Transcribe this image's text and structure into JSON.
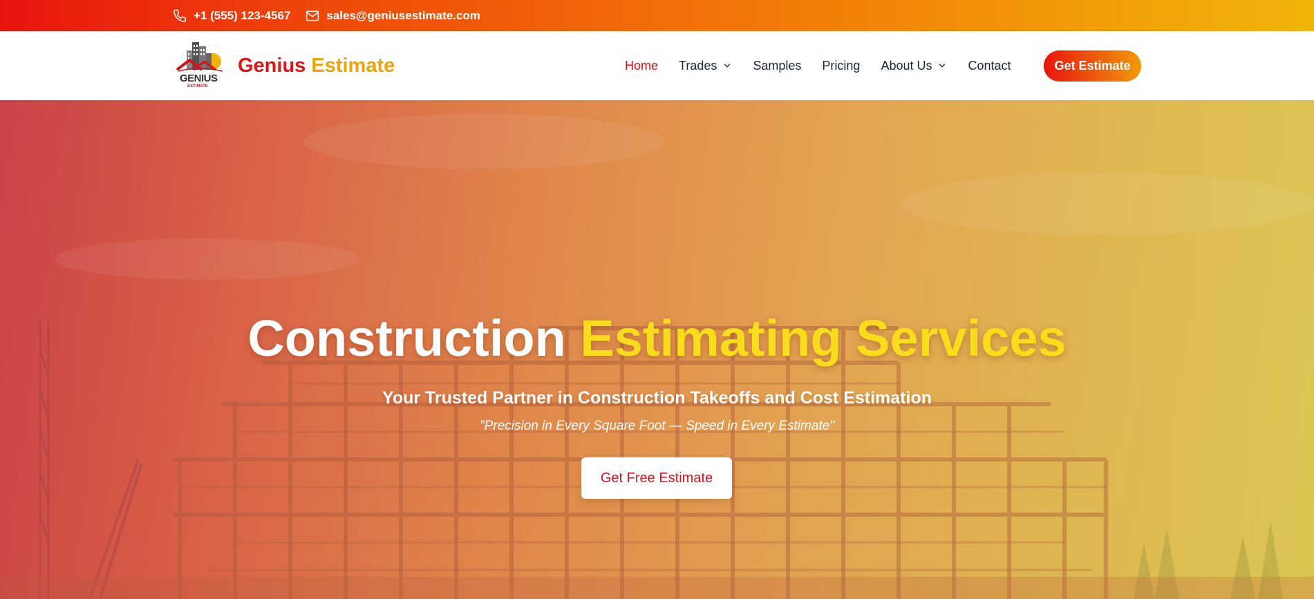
{
  "topbar": {
    "phone": "+1 (555) 123-4567",
    "email": "sales@geniusestimate.com"
  },
  "brand": {
    "logo_word": "GENIUS",
    "logo_sub": "ESTIMATE",
    "name_part1": "Genius",
    "name_part2": "Estimate"
  },
  "nav": {
    "items": [
      {
        "label": "Home",
        "active": true,
        "dropdown": false
      },
      {
        "label": "Trades",
        "active": false,
        "dropdown": true
      },
      {
        "label": "Samples",
        "active": false,
        "dropdown": false
      },
      {
        "label": "Pricing",
        "active": false,
        "dropdown": false
      },
      {
        "label": "About Us",
        "active": false,
        "dropdown": true
      },
      {
        "label": "Contact",
        "active": false,
        "dropdown": false
      }
    ],
    "cta_label": "Get Estimate"
  },
  "hero": {
    "title_part1": "Construction",
    "title_part2": "Estimating Services",
    "subtitle": "Your Trusted Partner in Construction Takeoffs and Cost Estimation",
    "quote": "\"Precision in Every Square Foot — Speed in Every Estimate\"",
    "button_label": "Get Free Estimate"
  },
  "colors": {
    "brand_red": "#df1414",
    "brand_gold": "#eca40c",
    "highlight_yellow": "#f9dd1c",
    "nav_text": "#1e2533"
  },
  "icons": {
    "phone": "phone-icon",
    "email": "mail-icon",
    "dropdown": "chevron-down-icon"
  }
}
